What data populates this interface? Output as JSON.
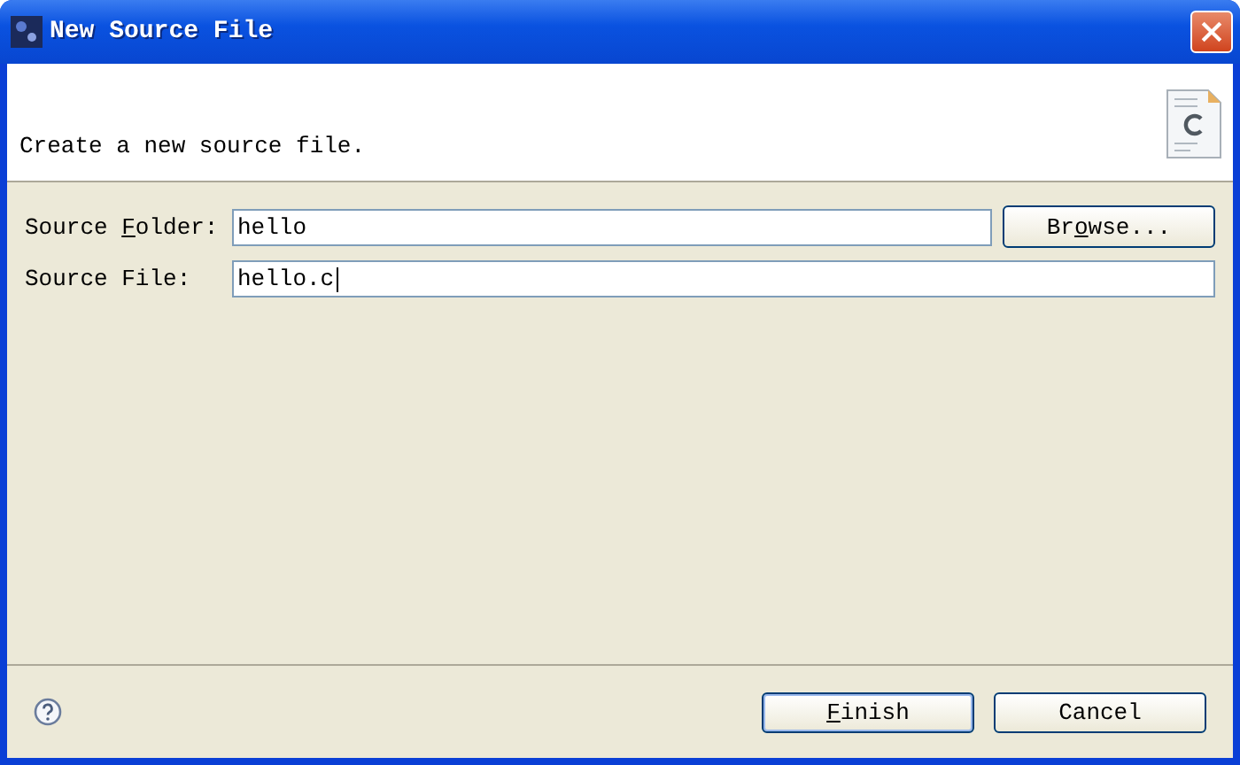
{
  "window": {
    "title": "New Source File"
  },
  "header": {
    "message": "Create a new source file."
  },
  "fields": [
    {
      "label": {
        "before": "Source ",
        "mnemonic": "F",
        "after": "older:"
      },
      "value": "hello",
      "button": {
        "before": "Br",
        "mnemonic": "o",
        "after": "wse..."
      }
    },
    {
      "label": {
        "before": "Source File:"
      },
      "value": "hello.c",
      "focused": true
    }
  ],
  "buttons": [
    {
      "mnemonic": "F",
      "after": "inish",
      "default": true
    },
    {
      "before": "Cancel",
      "default": false
    }
  ]
}
